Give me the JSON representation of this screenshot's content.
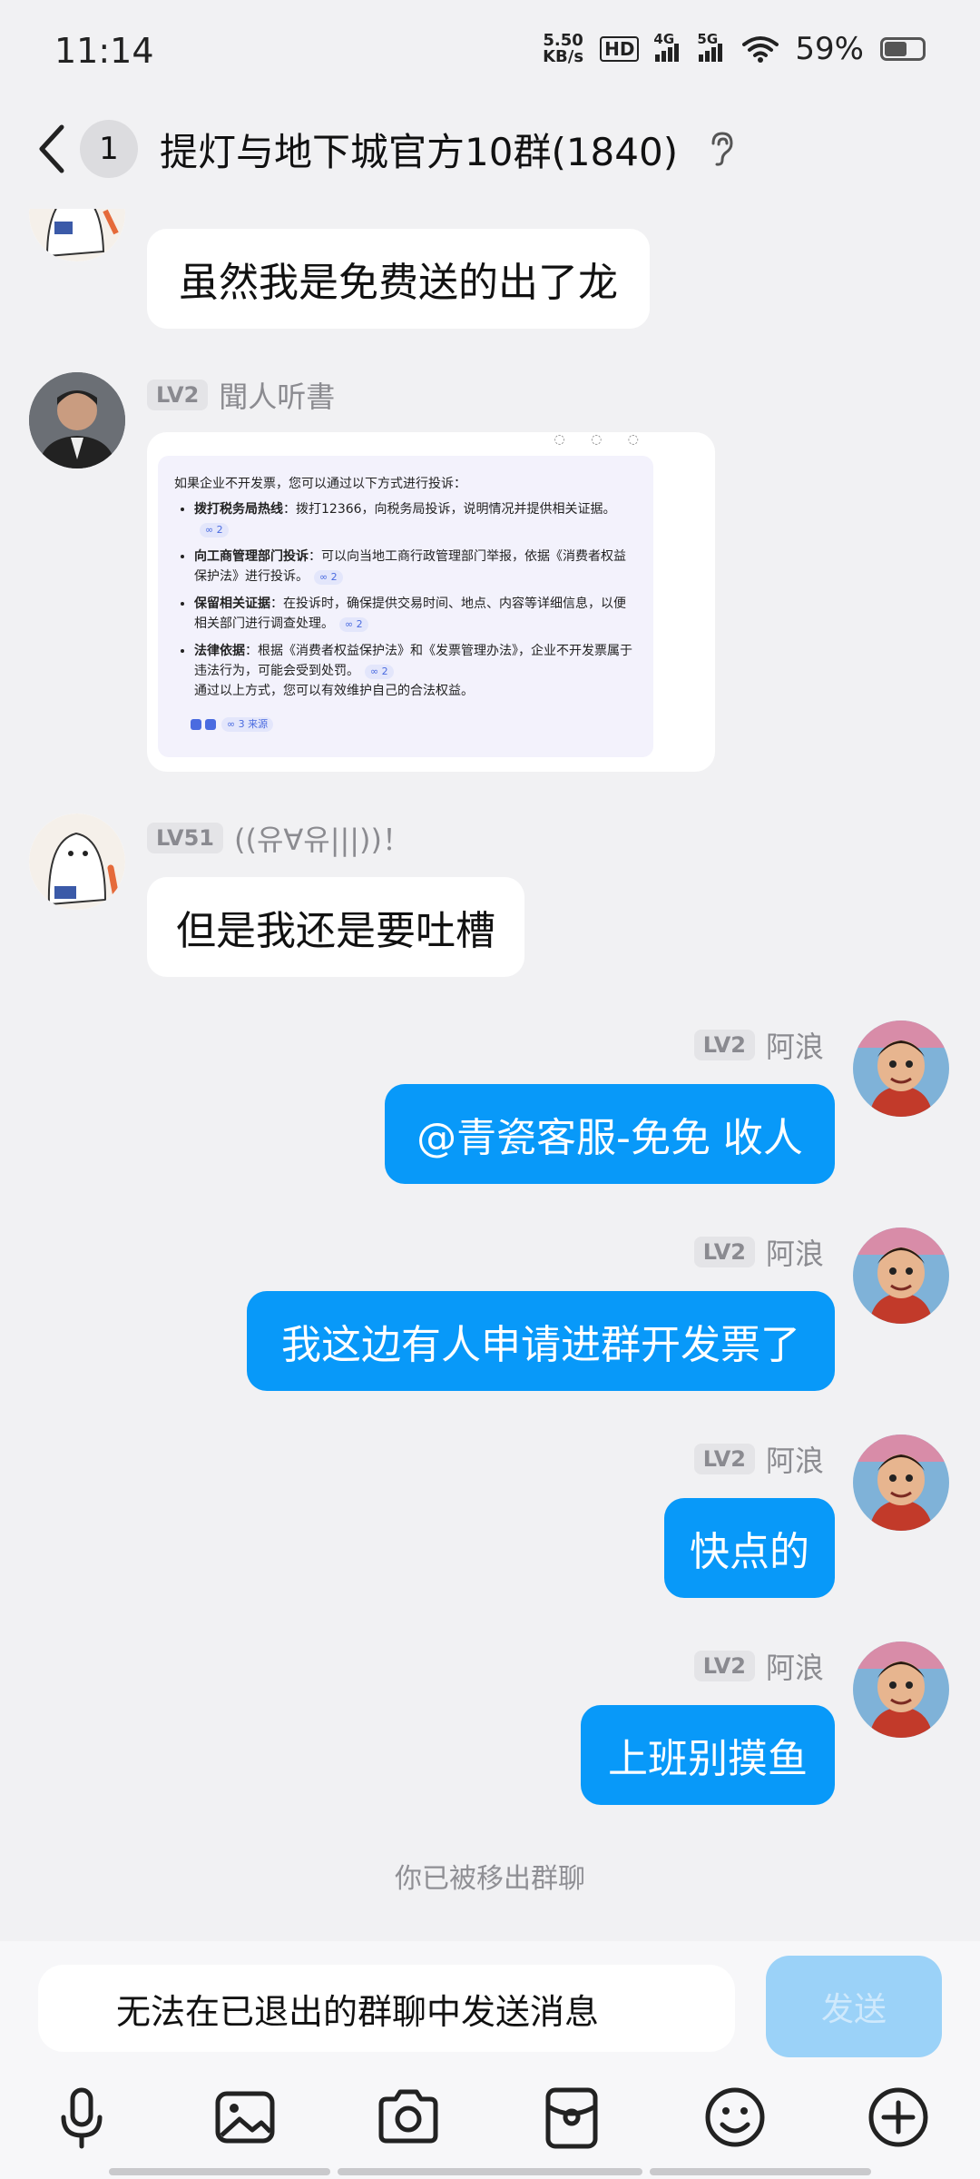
{
  "status_bar": {
    "time": "11:14",
    "net_speed_value": "5.50",
    "net_speed_unit": "KB/s",
    "hd_label": "HD",
    "signal_4g": "4G",
    "signal_5g": "5G",
    "battery_percent": "59%",
    "battery_level": 0.59
  },
  "header": {
    "unread_count": "1",
    "title": "提灯与地下城官方10群(1840)",
    "icons": {
      "back": "chevron-left-icon",
      "ear": "ear-icon"
    }
  },
  "messages": [
    {
      "side": "in",
      "text": "虽然我是免费送的出了龙"
    },
    {
      "side": "in",
      "level": "LV2",
      "nickname": "聞人听書",
      "type": "image",
      "image_content": {
        "intro": "如果企业不开发票，您可以通过以下方式进行投诉：",
        "items": [
          {
            "title": "拨打税务局热线",
            "text": "：拨打12366，向税务局投诉，说明情况并提供相关证据。",
            "ref": "∞ 2"
          },
          {
            "title": "向工商管理部门投诉",
            "text": "：可以向当地工商行政管理部门举报，依据《消费者权益保护法》进行投诉。",
            "ref": "∞ 2"
          },
          {
            "title": "保留相关证据",
            "text": "：在投诉时，确保提供交易时间、地点、内容等详细信息，以便相关部门进行调查处理。",
            "ref": "∞ 2"
          },
          {
            "title": "法律依据",
            "text": "：根据《消费者权益保护法》和《发票管理办法》，企业不开发票属于违法行为，可能会受到处罚。",
            "ref": "∞ 2"
          }
        ],
        "outro": "通过以上方式，您可以有效维护自己的合法权益。",
        "sources": "∞ 3 来源"
      }
    },
    {
      "side": "in",
      "level": "LV51",
      "nickname": "((유∀유|||))！",
      "text": "但是我还是要吐槽"
    },
    {
      "side": "out",
      "level": "LV2",
      "nickname": "阿浪",
      "text": "@青瓷客服-免免 收人"
    },
    {
      "side": "out",
      "level": "LV2",
      "nickname": "阿浪",
      "text": "我这边有人申请进群开发票了"
    },
    {
      "side": "out",
      "level": "LV2",
      "nickname": "阿浪",
      "text": "快点的"
    },
    {
      "side": "out",
      "level": "LV2",
      "nickname": "阿浪",
      "text": "上班别摸鱼"
    }
  ],
  "system_notice": "你已被移出群聊",
  "input": {
    "placeholder": "无法在已退出的群聊中发送消息",
    "send_label": "发送"
  },
  "toolbar": [
    "microphone-icon",
    "image-icon",
    "camera-icon",
    "red-packet-icon",
    "emoji-icon",
    "plus-icon"
  ],
  "colors": {
    "accent": "#0899f9",
    "background": "#f1f1f3",
    "send_disabled": "#9bd2f8"
  }
}
